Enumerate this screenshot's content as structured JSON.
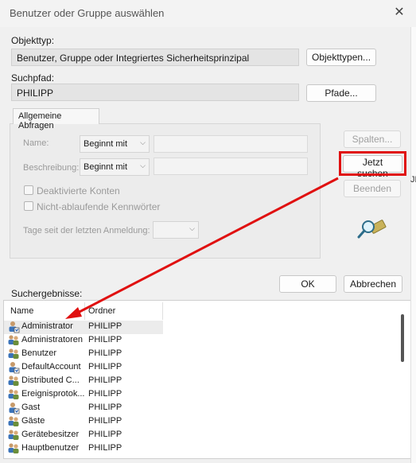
{
  "window": {
    "title": "Benutzer oder Gruppe auswählen"
  },
  "object_type": {
    "label": "Objekttyp:",
    "value": "Benutzer, Gruppe oder Integriertes Sicherheitsprinzipal",
    "button": "Objekttypen..."
  },
  "search_path": {
    "label": "Suchpfad:",
    "value": "PHILIPP",
    "button": "Pfade..."
  },
  "common_queries": {
    "tab_label": "Allgemeine Abfragen",
    "name_label": "Name:",
    "name_mode": "Beginnt mit",
    "desc_label": "Beschreibung:",
    "desc_mode": "Beginnt mit",
    "disabled_accounts": "Deaktivierte Konten",
    "non_expiring_pw": "Nicht-ablaufende Kennwörter",
    "days_since_login": "Tage seit der letzten Anmeldung:"
  },
  "side_buttons": {
    "columns": "Spalten...",
    "search_now": "Jetzt suchen",
    "stop": "Beenden"
  },
  "footer_buttons": {
    "ok": "OK",
    "cancel": "Abbrechen"
  },
  "results": {
    "label": "Suchergebnisse:",
    "col_name": "Name",
    "col_folder": "Ordner",
    "rows": [
      {
        "name": "Administrator",
        "folder": "PHILIPP",
        "kind": "user"
      },
      {
        "name": "Administratoren",
        "folder": "PHILIPP",
        "kind": "group"
      },
      {
        "name": "Benutzer",
        "folder": "PHILIPP",
        "kind": "group"
      },
      {
        "name": "DefaultAccount",
        "folder": "PHILIPP",
        "kind": "user"
      },
      {
        "name": "Distributed C...",
        "folder": "PHILIPP",
        "kind": "group"
      },
      {
        "name": "Ereignisprotok...",
        "folder": "PHILIPP",
        "kind": "group"
      },
      {
        "name": "Gast",
        "folder": "PHILIPP",
        "kind": "user"
      },
      {
        "name": "Gäste",
        "folder": "PHILIPP",
        "kind": "group"
      },
      {
        "name": "Gerätebesitzer",
        "folder": "PHILIPP",
        "kind": "group"
      },
      {
        "name": "Hauptbenutzer",
        "folder": "PHILIPP",
        "kind": "group"
      }
    ]
  },
  "edge_text": "JP",
  "colors": {
    "highlight": "#e01010",
    "arrow": "#e01010"
  }
}
